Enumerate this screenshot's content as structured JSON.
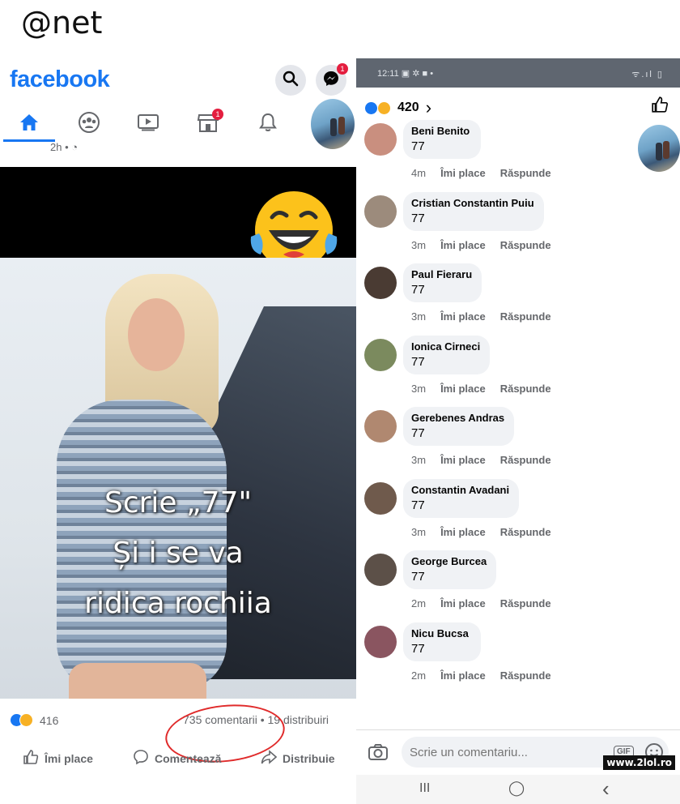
{
  "caption": "@net",
  "left": {
    "logo": "facebook",
    "messenger_badge": "1",
    "marketplace_badge": "1",
    "post_time": "2h •",
    "image_text": {
      "line1": "Scrie „77\"",
      "line2": "Și i se va",
      "line3": "ridica rochiia"
    },
    "reactions": "416",
    "comments": "735 comentarii",
    "dot": "•",
    "shares": "19 distribuiri",
    "actions": {
      "like": "Îmi place",
      "comment": "Comentează",
      "share": "Distribuie"
    }
  },
  "right": {
    "status": {
      "time": "12:11",
      "icons": "▣ ✲ ■ •",
      "right": "ᯤ.ıl ▯"
    },
    "header": {
      "count": "420",
      "chevron": "›"
    },
    "comments": [
      {
        "name": "Beni Benito",
        "text": "77",
        "time": "4m",
        "avatar_color": "#c98f7f"
      },
      {
        "name": "Cristian Constantin Puiu",
        "text": "77",
        "time": "3m",
        "avatar_color": "#9c8b7c"
      },
      {
        "name": "Paul Fieraru",
        "text": "77",
        "time": "3m",
        "avatar_color": "#4a3b33"
      },
      {
        "name": "Ionica Cirneci",
        "text": "77",
        "time": "3m",
        "avatar_color": "#7b8a5e"
      },
      {
        "name": "Gerebenes Andras",
        "text": "77",
        "time": "3m",
        "avatar_color": "#b08870"
      },
      {
        "name": "Constantin Avadani",
        "text": "77",
        "time": "3m",
        "avatar_color": "#6f5a4c"
      },
      {
        "name": "George Burcea",
        "text": "77",
        "time": "2m",
        "avatar_color": "#5c5048"
      },
      {
        "name": "Nicu Bucsa",
        "text": "77",
        "time": "2m",
        "avatar_color": "#8a5560"
      }
    ],
    "like_label": "Îmi place",
    "reply_label": "Răspunde",
    "write_placeholder": "Scrie un comentariu...",
    "gif_label": "GIF",
    "nav": {
      "recent": "III",
      "home": "◯",
      "back": "‹"
    }
  },
  "watermark": "www.2lol.ro",
  "colors": {
    "brand": "#1877f2",
    "circle": "#e02b2b",
    "badge": "#e41e3f"
  }
}
